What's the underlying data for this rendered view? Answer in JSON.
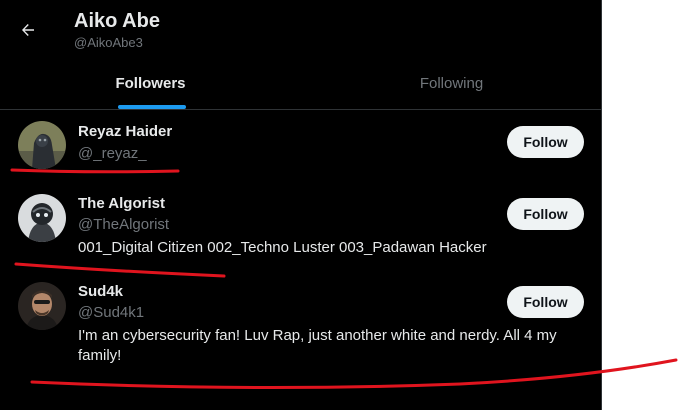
{
  "header": {
    "back_icon": "arrow-left-icon",
    "title": "Aiko Abe",
    "handle": "@AikoAbe3"
  },
  "tabs": [
    {
      "label": "Followers",
      "active": true
    },
    {
      "label": "Following",
      "active": false
    }
  ],
  "users": [
    {
      "name": "Reyaz Haider",
      "handle": "@_reyaz_",
      "bio": "",
      "follow_label": "Follow"
    },
    {
      "name": "The Algorist",
      "handle": "@TheAlgorist",
      "bio": "001_Digital Citizen 002_Techno Luster 003_Padawan Hacker",
      "follow_label": "Follow"
    },
    {
      "name": "Sud4k",
      "handle": "@Sud4k1",
      "bio": "I'm an cybersecurity fan! Luv Rap, just another white and nerdy. All 4 my family!",
      "follow_label": "Follow"
    }
  ],
  "colors": {
    "background": "#000000",
    "accent": "#1d9bf0",
    "annotation": "#e0141e"
  }
}
